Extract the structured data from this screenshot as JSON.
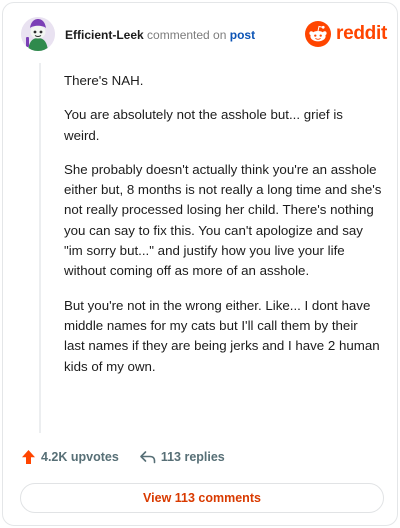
{
  "comment": {
    "author": "Efficient-Leek",
    "meta_text": "commented on",
    "post_link": "post",
    "paragraphs": [
      "There's NAH.",
      "You are absolutely not the asshole but... grief is weird.",
      "She probably doesn't actually think you're an asshole either but, 8 months is not really a long time and she's not really processed losing her child. There's nothing you can say to fix this. You can't apologize and say \"im sorry but...\" and justify how you live your life without coming off as more of an asshole.",
      "But you're not in the wrong either. Like... I dont have middle names for my cats but I'll call them by their last names if they are being jerks and I have 2 human kids of my own."
    ],
    "upvotes": "4.2K upvotes",
    "replies": "113 replies",
    "view_comments": "View 113 comments"
  },
  "brand": {
    "name": "reddit",
    "color": "#ff4500"
  },
  "icons": {
    "avatar": "snoo-avatar-icon",
    "brand": "reddit-logo-icon",
    "upvote": "upvote-arrow-icon",
    "reply": "reply-arrow-icon"
  }
}
